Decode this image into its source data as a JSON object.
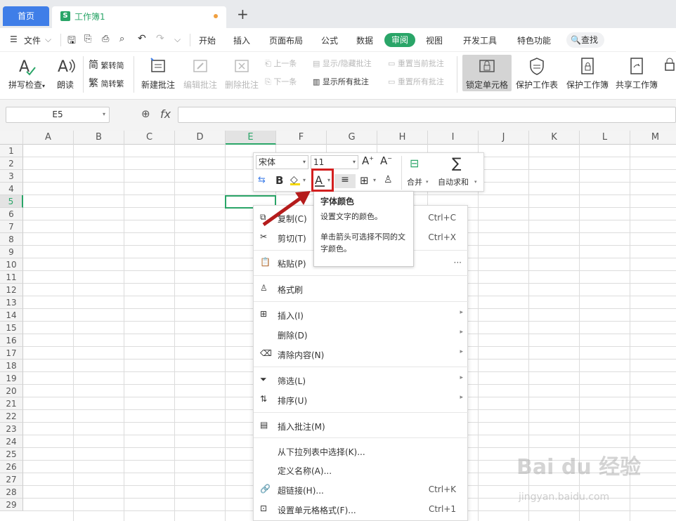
{
  "tabs": {
    "home": "首页",
    "doc_title": "工作簿1",
    "doc_icon": "S",
    "new_tab": "+"
  },
  "menu": {
    "file": "文件",
    "items": [
      "开始",
      "插入",
      "页面布局",
      "公式",
      "数据",
      "审阅",
      "视图",
      "开发工具",
      "特色功能"
    ],
    "active": "审阅",
    "search": "查找"
  },
  "ribbon": {
    "spell_check": "拼写检查",
    "read_aloud": "朗读",
    "to_traditional": "繁转简",
    "to_simplified": "简转繁",
    "new_comment": "新建批注",
    "edit_comment": "编辑批注",
    "delete_comment": "删除批注",
    "prev": "上一条",
    "next": "下一条",
    "show_hide_comment": "显示/隐藏批注",
    "show_all_comments": "显示所有批注",
    "reset_current_comment": "重置当前批注",
    "reset_all_comments": "重置所有批注",
    "lock_cell": "锁定单元格",
    "protect_sheet": "保护工作表",
    "protect_workbook": "保护工作簿",
    "share_workbook": "共享工作簿"
  },
  "formula_bar": {
    "name_box": "E5",
    "fx": "fx",
    "value": ""
  },
  "columns": [
    "A",
    "B",
    "C",
    "D",
    "E",
    "F",
    "G",
    "H",
    "I",
    "J",
    "K",
    "L",
    "M"
  ],
  "rows": [
    "1",
    "2",
    "3",
    "4",
    "5",
    "6",
    "7",
    "8",
    "9",
    "10",
    "11",
    "12",
    "13",
    "14",
    "15",
    "16",
    "17",
    "18",
    "19",
    "20",
    "21",
    "22",
    "23",
    "24",
    "25",
    "26",
    "27",
    "28",
    "29"
  ],
  "selected_cell": "E5",
  "mini_toolbar": {
    "font": "宋体",
    "size": "11",
    "merge": "合并",
    "autosum": "自动求和",
    "bold": "B"
  },
  "tooltip": {
    "title": "字体颜色",
    "line1": "设置文字的颜色。",
    "line2": "单击箭头可选择不同的文字颜色。"
  },
  "context_menu": {
    "copy": "复制(C)",
    "copy_sc": "Ctrl+C",
    "cut": "剪切(T)",
    "cut_sc": "Ctrl+X",
    "paste": "粘贴(P)",
    "paste_more": "···",
    "format_painter": "格式刷",
    "insert": "插入(I)",
    "delete": "删除(D)",
    "clear": "清除内容(N)",
    "filter": "筛选(L)",
    "sort": "排序(U)",
    "insert_comment": "插入批注(M)",
    "pick_from_list": "从下拉列表中选择(K)...",
    "define_name": "定义名称(A)...",
    "hyperlink": "超链接(H)...",
    "hyperlink_sc": "Ctrl+K",
    "format_cells": "设置单元格格式(F)...",
    "format_cells_sc": "Ctrl+1"
  },
  "watermark": {
    "brand": "Bai du 经验",
    "url": "jingyan.baidu.com"
  },
  "colors": {
    "accent": "#2aa568",
    "home_tab": "#3f7ee8",
    "highlight": "#d31f1f"
  }
}
